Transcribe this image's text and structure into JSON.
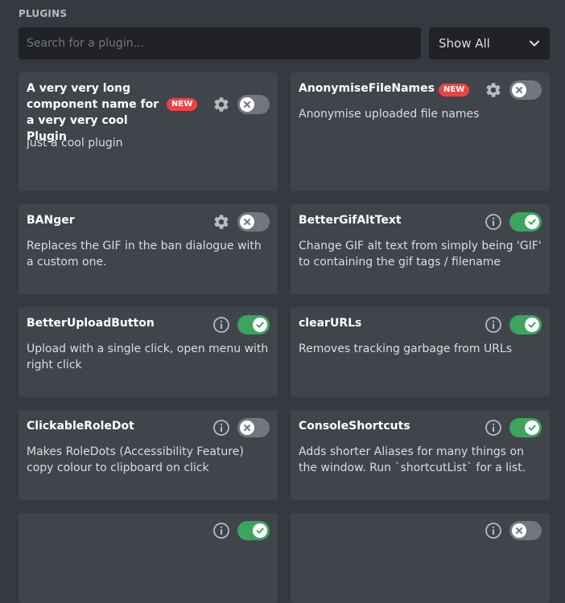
{
  "section_title": "PLUGINS",
  "search": {
    "placeholder": "Search for a plugin..."
  },
  "filter": {
    "label": "Show All"
  },
  "new_badge": "NEW",
  "colors": {
    "toggle_on": "#3ba55c",
    "toggle_off": "#72767d",
    "badge": "#ed4245"
  },
  "plugins": [
    {
      "name": "A very very long component name for a very very cool Plugin",
      "description": "just a cool plugin",
      "is_new": true,
      "action_icon": "gear-icon",
      "enabled": false
    },
    {
      "name": "AnonymiseFileNames",
      "description": "Anonymise uploaded file names",
      "is_new": true,
      "action_icon": "gear-icon",
      "enabled": false
    },
    {
      "name": "BANger",
      "description": "Replaces the GIF in the ban dialogue with a custom one.",
      "is_new": false,
      "action_icon": "gear-icon",
      "enabled": false
    },
    {
      "name": "BetterGifAltText",
      "description": "Change GIF alt text from simply being 'GIF' to containing the gif tags / filename",
      "is_new": false,
      "action_icon": "info-icon",
      "enabled": true
    },
    {
      "name": "BetterUploadButton",
      "description": "Upload with a single click, open menu with right click",
      "is_new": false,
      "action_icon": "info-icon",
      "enabled": true
    },
    {
      "name": "clearURLs",
      "description": "Removes tracking garbage from URLs",
      "is_new": false,
      "action_icon": "info-icon",
      "enabled": true
    },
    {
      "name": "ClickableRoleDot",
      "description": "Makes RoleDots (Accessibility Feature) copy colour to clipboard on click",
      "is_new": false,
      "action_icon": "info-icon",
      "enabled": false
    },
    {
      "name": "ConsoleShortcuts",
      "description": "Adds shorter Aliases for many things on the window. Run `shortcutList` for a list.",
      "is_new": false,
      "action_icon": "info-icon",
      "enabled": true
    },
    {
      "name": "",
      "description": "",
      "is_new": false,
      "action_icon": "info-icon",
      "enabled": true
    },
    {
      "name": "",
      "description": "",
      "is_new": false,
      "action_icon": "info-icon",
      "enabled": false
    }
  ]
}
